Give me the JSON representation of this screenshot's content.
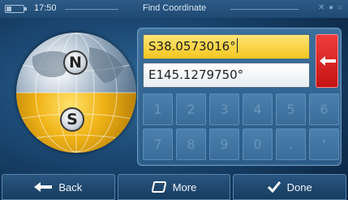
{
  "status": {
    "time": "17:50",
    "title": "Find Coordinate"
  },
  "globe": {
    "north_label": "N",
    "south_label": "S"
  },
  "fields": {
    "latitude": "S38.0573016°",
    "longitude": "E145.1279750°"
  },
  "keypad": {
    "keys": [
      "1",
      "2",
      "3",
      "4",
      "5",
      "6",
      "7",
      "8",
      "9",
      "0",
      ".",
      "'"
    ]
  },
  "bottom_bar": {
    "back_label": "Back",
    "more_label": "More",
    "done_label": "Done"
  },
  "colors": {
    "latitude_field": "#f6c71e",
    "backspace": "#d42020",
    "background": "#1a4670"
  },
  "icons": {
    "backspace": "left-arrow-icon",
    "back": "left-arrow-icon",
    "more": "rounded-square-icon",
    "done": "checkmark-icon"
  }
}
